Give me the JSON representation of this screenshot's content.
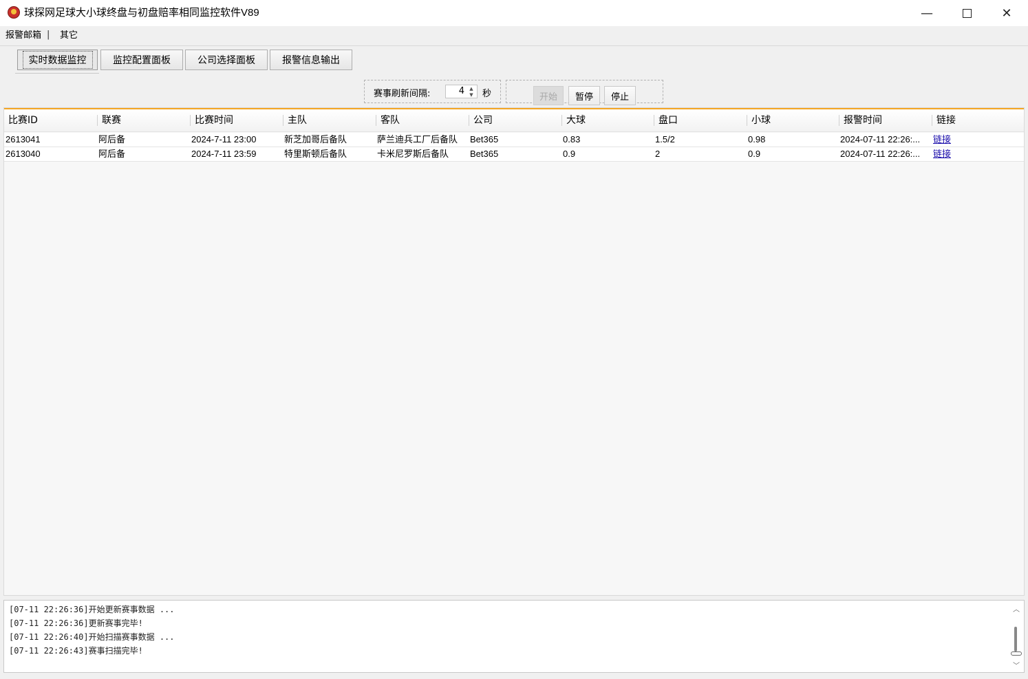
{
  "window": {
    "title": "球探网足球大小球终盘与初盘赔率相同监控软件V89",
    "min_glyph": "—",
    "close_glyph": "✕"
  },
  "menu": [
    "报警邮箱",
    "其它"
  ],
  "menu_separator": "|",
  "tabs": [
    {
      "label": "实时数据监控",
      "active": true
    },
    {
      "label": "监控配置面板",
      "active": false
    },
    {
      "label": "公司选择面板",
      "active": false
    },
    {
      "label": "报警信息输出",
      "active": false
    }
  ],
  "controls": {
    "refresh_label": "赛事刷新间隔:",
    "refresh_value": "4",
    "refresh_unit": "秒",
    "start_label": "开始",
    "pause_label": "暂停",
    "stop_label": "停止"
  },
  "table": {
    "columns": [
      "比赛ID",
      "联赛",
      "比赛时间",
      "主队",
      "客队",
      "公司",
      "大球",
      "盘口",
      "小球",
      "报警时间",
      "链接"
    ],
    "rows": [
      [
        "2613041",
        "阿后备",
        "2024-7-11 23:00",
        "新芝加哥后备队",
        "萨兰迪兵工厂后备队",
        "Bet365",
        "0.83",
        "1.5/2",
        "0.98",
        "2024-07-11 22:26:...",
        "链接"
      ],
      [
        "2613040",
        "阿后备",
        "2024-7-11 23:59",
        "特里斯顿后备队",
        "卡米尼罗斯后备队",
        "Bet365",
        "0.9",
        "2",
        "0.9",
        "2024-07-11 22:26:...",
        "链接"
      ]
    ]
  },
  "log": [
    "[07-11 22:26:36]开始更新赛事数据 ...",
    "[07-11 22:26:36]更新赛事完毕!",
    "[07-11 22:26:40]开始扫描赛事数据 ...",
    "[07-11 22:26:43]赛事扫描完毕!"
  ],
  "colors": {
    "accent": "#f5a623",
    "link": "#1a0dab"
  }
}
